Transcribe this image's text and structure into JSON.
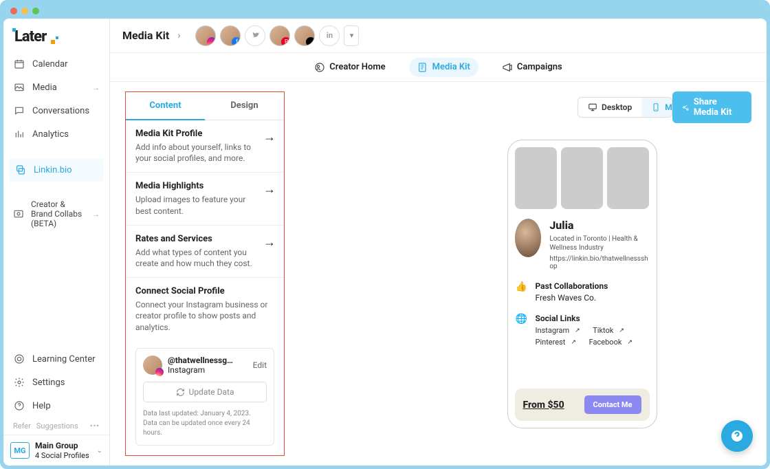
{
  "logo": "Later",
  "sidebar": {
    "items": [
      {
        "label": "Calendar"
      },
      {
        "label": "Media"
      },
      {
        "label": "Conversations"
      },
      {
        "label": "Analytics"
      },
      {
        "label": "Linkin.bio"
      },
      {
        "label": "Creator & Brand Collabs (BETA)"
      }
    ],
    "footer_items": [
      {
        "label": "Learning Center"
      },
      {
        "label": "Settings"
      },
      {
        "label": "Help"
      }
    ],
    "mini_links": {
      "refer": "Refer",
      "suggestions": "Suggestions"
    },
    "maingroup": {
      "badge": "MG",
      "title": "Main Group",
      "subtitle": "4 Social Profiles"
    }
  },
  "topbar": {
    "title": "Media Kit"
  },
  "subnav": {
    "creator": "Creator Home",
    "mediakit": "Media Kit",
    "campaigns": "Campaigns"
  },
  "panel": {
    "tabs": {
      "content": "Content",
      "design": "Design"
    },
    "sections": {
      "profile": {
        "title": "Media Kit Profile",
        "desc": "Add info about yourself, links to your social profiles, and more."
      },
      "highlights": {
        "title": "Media Highlights",
        "desc": "Upload images to feature your best content."
      },
      "rates": {
        "title": "Rates and Services",
        "desc": "Add what types of content you create and how much they cost."
      },
      "connect": {
        "title": "Connect Social Profile",
        "desc": "Connect your Instagram business or creator profile to show posts and analytics."
      }
    },
    "social": {
      "handle": "@thatwellnessg…",
      "network": "Instagram",
      "edit": "Edit",
      "update": "Update Data",
      "note1": "Data last updated: January 4, 2023.",
      "note2": "Data can be updated once every 24 hours."
    }
  },
  "preview": {
    "seg": {
      "desktop": "Desktop",
      "mobile": "Mobile"
    },
    "share": "Share Media Kit"
  },
  "phone": {
    "name": "Julia",
    "meta": "Located in Toronto | Health & Wellness Industry",
    "link": "https://linkin.bio/thatwellnessshop",
    "past_title": "Past Collaborations",
    "past_value": "Fresh Waves Co.",
    "social_title": "Social Links",
    "links": {
      "ig": "Instagram",
      "tt": "Tiktok",
      "pn": "Pinterest",
      "fb": "Facebook"
    },
    "price": "From $50",
    "contact": "Contact Me"
  }
}
